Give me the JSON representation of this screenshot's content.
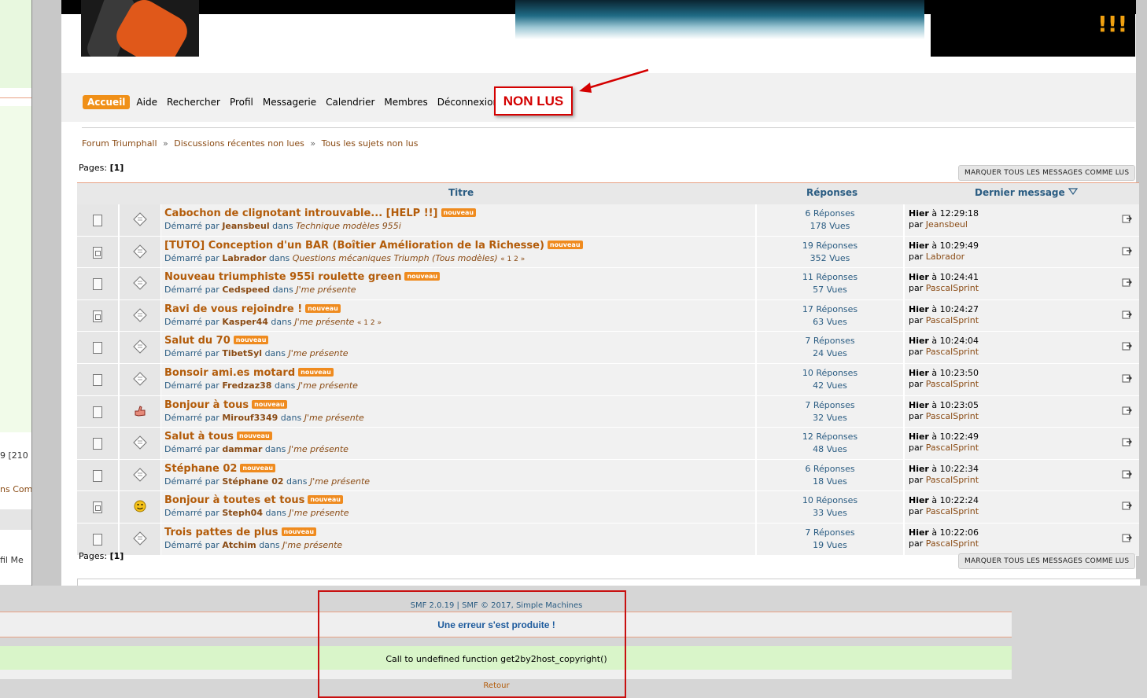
{
  "left_fragments": [
    "9 [210",
    "ns Com",
    "fil    Me"
  ],
  "header": {
    "exclamation": "!!!"
  },
  "menu": {
    "items": [
      "Accueil",
      "Aide",
      "Rechercher",
      "Profil",
      "Messagerie",
      "Calendrier",
      "Membres",
      "Déconnexion"
    ]
  },
  "annotation": {
    "label": "NON LUS"
  },
  "breadcrumb": [
    "Forum Triumphall",
    "Discussions récentes non lues",
    "Tous les sujets non lus"
  ],
  "breadcrumb_sep": "»",
  "pages": {
    "label": "Pages:",
    "value": "[1]"
  },
  "mark_button": "MARQUER TOUS LES MESSAGES COMME LUS",
  "table": {
    "headers": {
      "title": "Titre",
      "replies": "Réponses",
      "last": "Dernier message"
    },
    "new_badge": "nouveau",
    "started_by": "Démarré par",
    "in_word": "dans",
    "by_word": "par",
    "rows": [
      {
        "title": "Cabochon de clignotant introuvable... [HELP !!]",
        "author": "Jeansbeul",
        "board": "Technique modèles 955i",
        "pages": "",
        "replies": "6 Réponses",
        "views": "178 Vues",
        "day": "Hier",
        "time": "à 12:29:18",
        "last_by": "Jeansbeul",
        "hot": false,
        "icon": "xx"
      },
      {
        "title": "[TUTO] Conception d'un BAR (Boîtier Amélioration de la Richesse)",
        "author": "Labrador",
        "board": "Questions mécaniques Triumph (Tous modèles)",
        "pages": "« 1 2 »",
        "replies": "19 Réponses",
        "views": "352 Vues",
        "day": "Hier",
        "time": "à 10:29:49",
        "last_by": "Labrador",
        "hot": true,
        "icon": "xx"
      },
      {
        "title": "Nouveau triumphiste 955i roulette green",
        "author": "Cedspeed",
        "board": "J'me présente",
        "pages": "",
        "replies": "11 Réponses",
        "views": "57 Vues",
        "day": "Hier",
        "time": "à 10:24:41",
        "last_by": "PascalSprint",
        "hot": false,
        "icon": "xx"
      },
      {
        "title": "Ravi de vous rejoindre !",
        "author": "Kasper44",
        "board": "J'me présente",
        "pages": "« 1 2 »",
        "replies": "17 Réponses",
        "views": "63 Vues",
        "day": "Hier",
        "time": "à 10:24:27",
        "last_by": "PascalSprint",
        "hot": true,
        "icon": "xx"
      },
      {
        "title": "Salut du 70",
        "author": "TibetSyl",
        "board": "J'me présente",
        "pages": "",
        "replies": "7 Réponses",
        "views": "24 Vues",
        "day": "Hier",
        "time": "à 10:24:04",
        "last_by": "PascalSprint",
        "hot": false,
        "icon": "xx"
      },
      {
        "title": "Bonsoir ami.es motard",
        "author": "Fredzaz38",
        "board": "J'me présente",
        "pages": "",
        "replies": "10 Réponses",
        "views": "42 Vues",
        "day": "Hier",
        "time": "à 10:23:50",
        "last_by": "PascalSprint",
        "hot": false,
        "icon": "xx"
      },
      {
        "title": "Bonjour à tous",
        "author": "Mirouf3349",
        "board": "J'me présente",
        "pages": "",
        "replies": "7 Réponses",
        "views": "32 Vues",
        "day": "Hier",
        "time": "à 10:23:05",
        "last_by": "PascalSprint",
        "hot": false,
        "icon": "thumbup"
      },
      {
        "title": "Salut à tous",
        "author": "dammar",
        "board": "J'me présente",
        "pages": "",
        "replies": "12 Réponses",
        "views": "48 Vues",
        "day": "Hier",
        "time": "à 10:22:49",
        "last_by": "PascalSprint",
        "hot": false,
        "icon": "xx"
      },
      {
        "title": "Stéphane 02",
        "author": "Stéphane 02",
        "board": "J'me présente",
        "pages": "",
        "replies": "6 Réponses",
        "views": "18 Vues",
        "day": "Hier",
        "time": "à 10:22:34",
        "last_by": "PascalSprint",
        "hot": false,
        "icon": "xx"
      },
      {
        "title": "Bonjour à toutes et tous",
        "author": "Steph04",
        "board": "J'me présente",
        "pages": "",
        "replies": "10 Réponses",
        "views": "33 Vues",
        "day": "Hier",
        "time": "à 10:22:24",
        "last_by": "PascalSprint",
        "hot": true,
        "icon": "smiley"
      },
      {
        "title": "Trois pattes de plus",
        "author": "Atchim",
        "board": "J'me présente",
        "pages": "",
        "replies": "7 Réponses",
        "views": "19 Vues",
        "day": "Hier",
        "time": "à 10:22:06",
        "last_by": "PascalSprint",
        "hot": false,
        "icon": "xx"
      }
    ]
  },
  "footer": {
    "smf": "SMF 2.0.19 | SMF © 2017, Simple Machines",
    "error_title": "Une erreur s'est produite !",
    "error_message": "Call to undefined function get2by2host_copyright()",
    "back": "Retour"
  },
  "colors": {
    "accent": "#f09018",
    "link": "#2a5c82",
    "title": "#b35c0a",
    "annotation": "#d40000"
  }
}
